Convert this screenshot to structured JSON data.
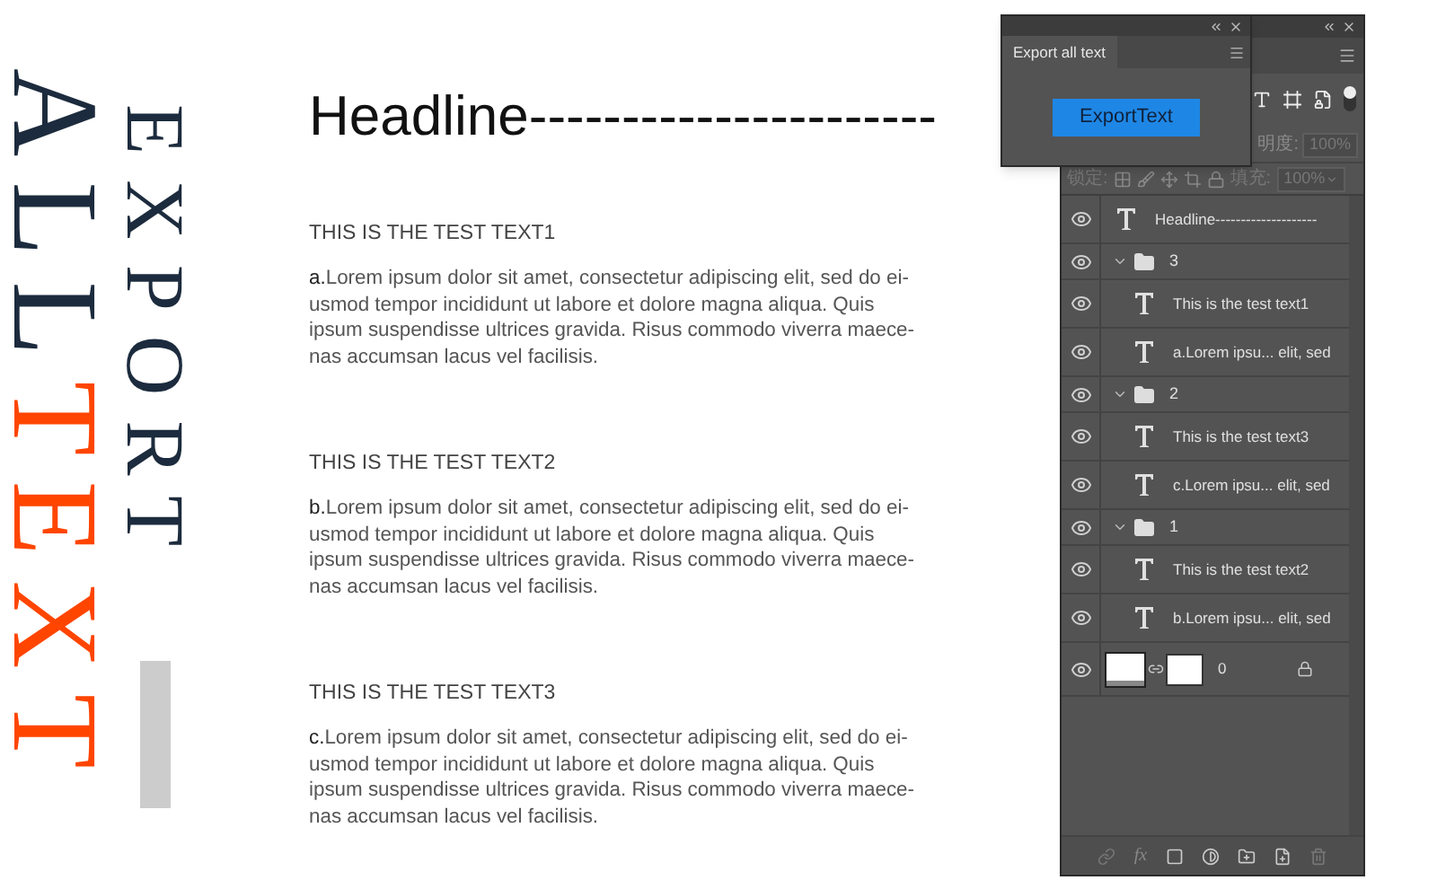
{
  "title_art": {
    "line1": "EXPORT",
    "line2": [
      {
        "text": "ALL",
        "kind": "dark"
      },
      {
        "text": "TEXT",
        "kind": "accent"
      }
    ]
  },
  "headline": "Headline----------------------",
  "sections": [
    {
      "title": "THIS IS THE TEST TEXT1",
      "lines": [
        "**a.**Lorem ipsum dolor sit amet, consectetur adipiscing elit, sed do ei-",
        "usmod tempor incididunt ut labore et dolore magna aliqua. Quis",
        "ipsum suspendisse ultrices gravida. Risus commodo viverra maece-",
        "nas accumsan lacus vel facilisis."
      ]
    },
    {
      "title": "THIS IS THE TEST TEXT2",
      "lines": [
        "**b.**Lorem ipsum dolor sit amet, consectetur adipiscing elit, sed do ei-",
        "usmod tempor incididunt ut labore et dolore magna aliqua. Quis",
        "ipsum suspendisse ultrices gravida. Risus commodo viverra maece-",
        "nas accumsan lacus vel facilisis."
      ]
    },
    {
      "title": "THIS IS THE TEST TEXT3",
      "lines": [
        "**c.**Lorem ipsum dolor sit amet, consectetur adipiscing elit, sed do ei-",
        "usmod tempor incididunt ut labore et dolore magna aliqua. Quis",
        "ipsum suspendisse ultrices gravida. Risus commodo viverra maece-",
        "nas accumsan lacus vel facilisis."
      ]
    }
  ],
  "export_panel": {
    "tab": "Export all text",
    "button": "ExportText"
  },
  "layers_panel": {
    "fx_label": "fx",
    "opacity_label": "明度:",
    "opacity": "100%",
    "lock_label": "锁定:",
    "fill_label": "填充:",
    "fill": "100%",
    "layers": [
      {
        "kind": "text",
        "name": "Headline--------------------",
        "visible": true
      },
      {
        "kind": "group",
        "name": "3",
        "visible": true,
        "expanded": true,
        "children": [
          {
            "kind": "text",
            "name": "This is the test text1",
            "visible": true
          },
          {
            "kind": "text",
            "name": "a.Lorem ipsu... elit, sed",
            "visible": true
          }
        ]
      },
      {
        "kind": "group",
        "name": "2",
        "visible": true,
        "expanded": true,
        "children": [
          {
            "kind": "text",
            "name": "This is the test text3",
            "visible": true
          },
          {
            "kind": "text",
            "name": "c.Lorem ipsu... elit, sed",
            "visible": true
          }
        ]
      },
      {
        "kind": "group",
        "name": "1",
        "visible": true,
        "expanded": true,
        "children": [
          {
            "kind": "text",
            "name": "This is the test text2",
            "visible": true
          },
          {
            "kind": "text",
            "name": "b.Lorem ipsu... elit, sed",
            "visible": true
          }
        ]
      },
      {
        "kind": "image",
        "name": "0",
        "visible": true,
        "locked": true
      }
    ]
  }
}
